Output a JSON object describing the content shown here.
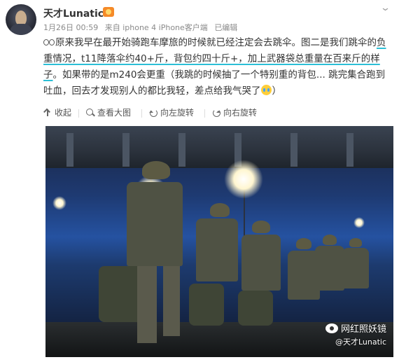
{
  "post": {
    "username": "天才Lunatic",
    "meta": {
      "date": "1月26日 00:59",
      "source": "来自 iphone 4 iPhone客户端",
      "edited": "已编辑"
    },
    "text": {
      "part1": "原来我早在最开始骑跑车摩旅的时候就已经注定会去跳伞。图二是我们跳伞的",
      "part2_hl": "负重情况，t11降落伞约40+斤，背包约四十斤+，加上武器袋总重量在百来斤的样子",
      "part3": "。如果带的是m240会更重（我跳的时候抽了一个特别重的背包... 跳完集合跑到吐血，回去才发现别人的都比我轻，差点给我气哭了",
      "part4": "）"
    }
  },
  "toolbar": {
    "collapse": "收起",
    "view_large": "查看大图",
    "rotate_left": "向左旋转",
    "rotate_right": "向右旋转"
  },
  "image": {
    "watermark_title": "网红照妖镜",
    "watermark_sub": "@天才Lunatic"
  },
  "colors": {
    "highlight_underline": "#2cbfd6",
    "badge": "#f58a28"
  },
  "icons": [
    "avatar",
    "vip-badge-icon",
    "more-chevron-icon",
    "glasses-emoji-icon",
    "crying-emoji-icon",
    "collapse-up-icon",
    "zoom-icon",
    "rotate-left-icon",
    "rotate-right-icon",
    "wechat-logo-icon"
  ]
}
